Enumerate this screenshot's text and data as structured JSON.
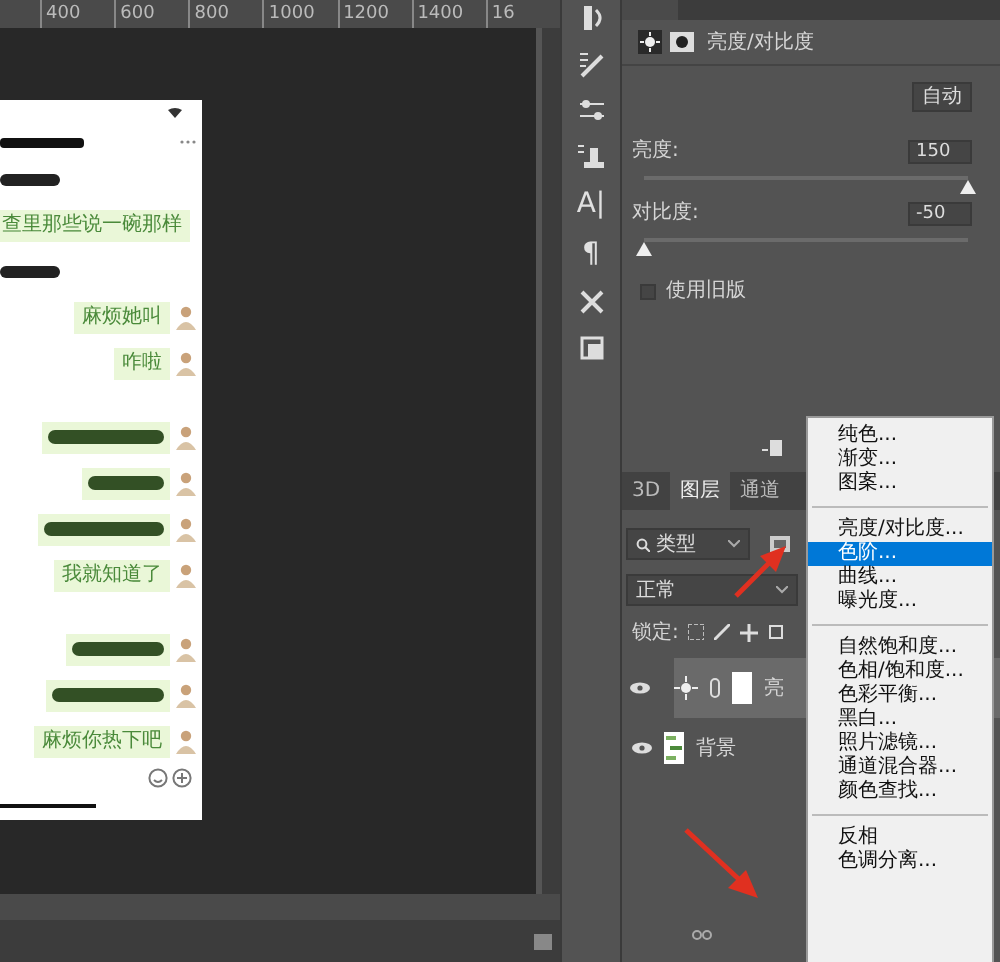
{
  "ruler": {
    "marks": [
      "400",
      "600",
      "800",
      "1000",
      "1200",
      "1400",
      "16"
    ]
  },
  "document": {
    "messages": [
      {
        "kind": "scribble"
      },
      {
        "kind": "text",
        "text": "查里那些说一碗那样"
      },
      {
        "kind": "scribble"
      },
      {
        "kind": "text",
        "text": "麻烦她叫"
      },
      {
        "kind": "text",
        "text": "咋啦"
      },
      {
        "kind": "gap"
      },
      {
        "kind": "redacted"
      },
      {
        "kind": "redacted"
      },
      {
        "kind": "redacted"
      },
      {
        "kind": "text",
        "text": "我就知道了"
      },
      {
        "kind": "gap"
      },
      {
        "kind": "redacted"
      },
      {
        "kind": "redacted"
      },
      {
        "kind": "text",
        "text": "麻烦你热下吧"
      }
    ]
  },
  "toolbar": [
    {
      "kind": "history"
    },
    {
      "kind": "brush"
    },
    {
      "kind": "sliders"
    },
    {
      "kind": "stamp"
    },
    {
      "kind": "glyph",
      "text": "A|"
    },
    {
      "kind": "glyph",
      "text": "¶"
    },
    {
      "kind": "tools"
    },
    {
      "kind": "layers"
    }
  ],
  "properties": {
    "title": "亮度/对比度",
    "auto_button": "自动",
    "sliders": [
      {
        "label": "亮度:",
        "value": "150",
        "level": 1
      },
      {
        "label": "对比度:",
        "value": "-50",
        "level": 0
      }
    ],
    "legacy": {
      "label": "使用旧版",
      "checked": false
    }
  },
  "layers_panel": {
    "tabs": [
      {
        "label": "3D",
        "selected": false
      },
      {
        "label": "图层",
        "selected": true
      },
      {
        "label": "通道",
        "selected": false
      }
    ],
    "filter": "类型",
    "blend_mode": "正常",
    "lock_label": "锁定:",
    "layers": [
      {
        "kind": "adjustment",
        "name": "亮",
        "visible": true,
        "selected": true
      },
      {
        "kind": "image",
        "name": "背景",
        "visible": true,
        "selected": false
      }
    ]
  },
  "menu": {
    "groups": [
      [
        {
          "label": "纯色...",
          "selected": false
        },
        {
          "label": "渐变...",
          "selected": false
        },
        {
          "label": "图案...",
          "selected": false
        }
      ],
      [
        {
          "label": "亮度/对比度...",
          "selected": false
        },
        {
          "label": "色阶...",
          "selected": true
        },
        {
          "label": "曲线...",
          "selected": false
        },
        {
          "label": "曝光度...",
          "selected": false
        }
      ],
      [
        {
          "label": "自然饱和度...",
          "selected": false
        },
        {
          "label": "色相/饱和度...",
          "selected": false
        },
        {
          "label": "色彩平衡...",
          "selected": false
        },
        {
          "label": "黑白...",
          "selected": false
        },
        {
          "label": "照片滤镜...",
          "selected": false
        },
        {
          "label": "通道混合器...",
          "selected": false
        },
        {
          "label": "颜色查找...",
          "selected": false
        }
      ],
      [
        {
          "label": "反相",
          "selected": false
        },
        {
          "label": "色调分离...",
          "selected": false
        }
      ]
    ]
  }
}
